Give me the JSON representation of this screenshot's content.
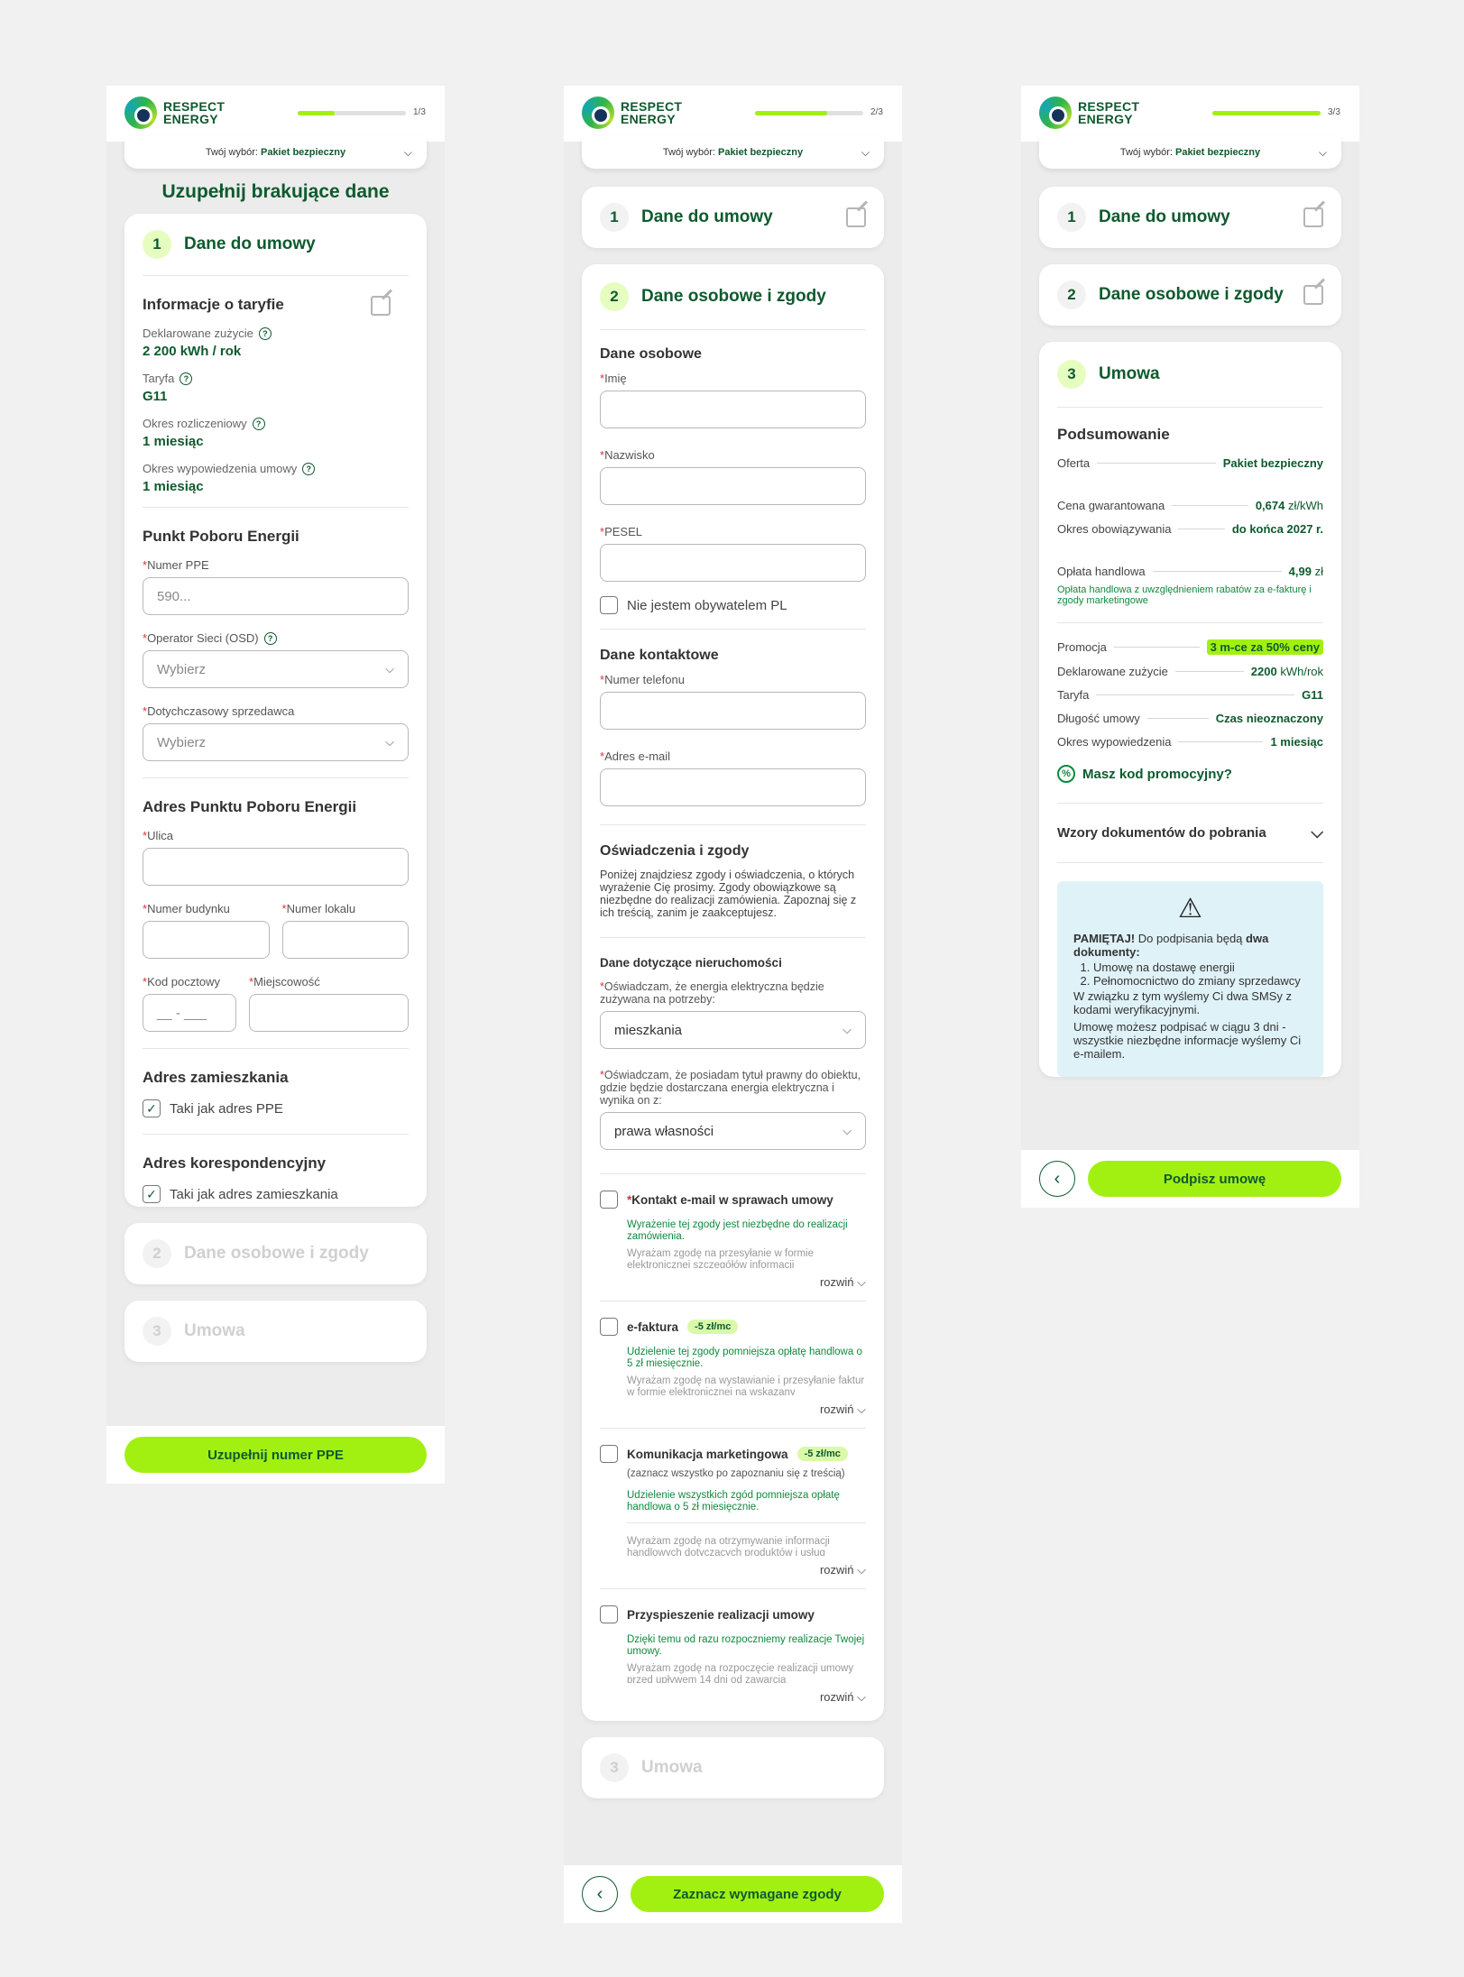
{
  "brand": {
    "line1": "RESPECT",
    "line2": "ENERGY"
  },
  "choice": {
    "label": "Twój wybór:",
    "value": "Pakiet bezpieczny"
  },
  "screen1": {
    "step": "1/3",
    "progress": 0.34,
    "title": "Uzupełnij brakujące dane",
    "card1": {
      "num": "1",
      "title": "Dane do umowy"
    },
    "tariff": {
      "title": "Informacje o taryfie",
      "items": [
        {
          "label": "Deklarowane zużycie",
          "value": "2 200 kWh / rok"
        },
        {
          "label": "Taryfa",
          "value": "G11"
        },
        {
          "label": "Okres rozliczeniowy",
          "value": "1 miesiąc"
        },
        {
          "label": "Okres wypowiedzenia umowy",
          "value": "1 miesiąc"
        }
      ]
    },
    "ppe": {
      "title": "Punkt Poboru Energii",
      "number_label": "Numer PPE",
      "number_placeholder": "590...",
      "osd_label": "Operator Sieci (OSD)",
      "osd_value": "Wybierz",
      "seller_label": "Dotychczasowy sprzedawca",
      "seller_value": "Wybierz"
    },
    "address": {
      "title": "Adres Punktu Poboru Energii",
      "street": "Ulica",
      "building": "Numer budynku",
      "apartment": "Numer lokalu",
      "zip": "Kod pocztowy",
      "zip_placeholder": "__ - ___",
      "city": "Miejscowość"
    },
    "residence": {
      "title": "Adres zamieszkania",
      "check": "Taki jak adres PPE"
    },
    "correspondence": {
      "title": "Adres korespondencyjny",
      "check": "Taki jak adres zamieszkania"
    },
    "card2": {
      "num": "2",
      "title": "Dane osobowe i zgody"
    },
    "card3": {
      "num": "3",
      "title": "Umowa"
    },
    "button": "Uzupełnij numer PPE"
  },
  "screen2": {
    "step": "2/3",
    "progress": 0.67,
    "card1": {
      "num": "1",
      "title": "Dane do umowy"
    },
    "card2": {
      "num": "2",
      "title": "Dane osobowe i zgody"
    },
    "personal": {
      "title": "Dane osobowe",
      "first": "Imię",
      "last": "Nazwisko",
      "pesel": "PESEL",
      "not_citizen": "Nie jestem obywatelem PL"
    },
    "contact": {
      "title": "Dane kontaktowe",
      "phone": "Numer telefonu",
      "email": "Adres e-mail"
    },
    "consents": {
      "title": "Oświadczenia i zgody",
      "intro": "Poniżej znajdziesz zgody i oświadczenia, o których wyrażenie Cię prosimy. Zgody obowiązkowe są niezbędne do realizacji zamówienia. Zapoznaj się z ich treścią, zanim je zaakceptujesz.",
      "property_title": "Dane dotyczące nieruchomości",
      "use_label": "Oświadczam, że energia elektryczna będzie zużywana na potrzeby:",
      "use_value": "mieszkania",
      "title_label": "Oświadczam, że posiadam tytuł prawny do obiektu, gdzie będzie dostarczana energia elektryczna i wynika on z:",
      "title_value": "prawa własności",
      "expand": "rozwiń",
      "items": [
        {
          "label": "Kontakt e-mail w sprawach umowy",
          "required": true,
          "chip": "",
          "note": "",
          "green": "Wyrażenie tej zgody jest niezbędne do realizacji zamówienia.",
          "fade": "Wyrażam zgodę na przesyłanie w formie elektronicznej szczegółów informacji"
        },
        {
          "label": "e-faktura",
          "required": false,
          "chip": "-5 zł/mc",
          "note": "",
          "green": "Udzielenie tej zgody pomniejsza opłatę handlowa o 5 zł miesięcznie.",
          "fade": "Wyrażam zgodę na wystawianie i przesyłanie faktur w formie elektronicznej na wskazany"
        },
        {
          "label": "Komunikacja marketingowa",
          "required": false,
          "chip": "-5 zł/mc",
          "note": "(zaznacz wszystko po zapoznaniu się z treścią)",
          "green": "Udzielenie wszystkich zgód pomniejsza opłatę handlowa o 5 zł miesięcznie.",
          "fade": "Wyrażam zgodę na otrzymywanie informacji handlowych dotyczących produktów i usług"
        },
        {
          "label": "Przyspieszenie realizacji umowy",
          "required": false,
          "chip": "",
          "note": "",
          "green": "Dzięki temu od razu rozpoczniemy realizacje Twojej umowy.",
          "fade": "Wyrażam zgodę na rozpoczęcie realizacji umowy przed upływem 14 dni od zawarcia"
        }
      ]
    },
    "card3": {
      "num": "3",
      "title": "Umowa"
    },
    "button": "Zaznacz wymagane zgody"
  },
  "screen3": {
    "step": "3/3",
    "progress": 1.0,
    "card1": {
      "num": "1",
      "title": "Dane do umowy"
    },
    "card2": {
      "num": "2",
      "title": "Dane osobowe i zgody"
    },
    "card3": {
      "num": "3",
      "title": "Umowa"
    },
    "summary": {
      "title": "Podsumowanie",
      "offer_label": "Oferta",
      "offer": "Pakiet bezpieczny",
      "price_label": "Cena gwarantowana",
      "price": "0,674",
      "price_unit": "zł/kWh",
      "validity_label": "Okres obowiązywania",
      "validity": "do końca 2027 r.",
      "fee_label": "Opłata handlowa",
      "fee": "4,99",
      "fee_unit": "zł",
      "fee_note": "Opłata handlowa z uwzględnieniem rabatów za e-fakturę i zgody marketingowe",
      "promo_label": "Promocja",
      "promo": "3 m-ce za 50% ceny",
      "usage_label": "Deklarowane zużycie",
      "usage": "2200",
      "usage_unit": "kWh/rok",
      "tariff_label": "Taryfa",
      "tariff": "G11",
      "length_label": "Długość umowy",
      "length": "Czas nieoznaczony",
      "notice_label": "Okres wypowiedzenia",
      "notice": "1 miesiąc"
    },
    "promo_code": "Masz kod promocyjny?",
    "docs": "Wzory dokumentów do pobrania",
    "remember": {
      "lead": "PAMIĘTAJ!",
      "text1": "Do podpisania będą",
      "bold1": "dwa dokumenty:",
      "items": [
        "Umowę na dostawę energii",
        "Pełnomocnictwo do zmiany sprzedawcy"
      ],
      "text2": "W związku z tym wyślemy Ci dwa SMSy z kodami weryfikacyjnymi.",
      "text3": "Umowę możesz podpisać w ciągu 3 dni - wszystkie niezbędne informacje wyślemy Ci e-mailem."
    },
    "button": "Podpisz umowę"
  }
}
